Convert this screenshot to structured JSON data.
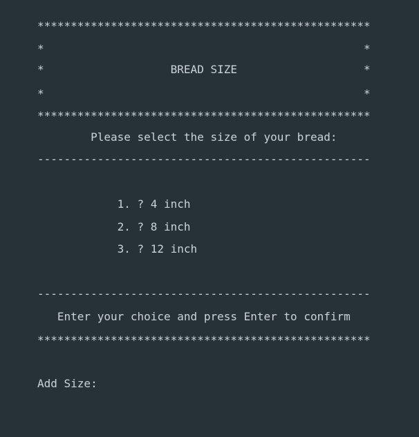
{
  "terminal": {
    "border_stars": "**************************************************",
    "frame_blank": "*                                                *",
    "title_line": "*                   BREAD SIZE                   *",
    "prompt": "        Please select the size of your bread:",
    "divider": "--------------------------------------------------",
    "options": [
      "            1. ? 4 inch",
      "            2. ? 8 inch",
      "            3. ? 12 inch"
    ],
    "instruction": "   Enter your choice and press Enter to confirm",
    "input_label": "Add Size:"
  }
}
